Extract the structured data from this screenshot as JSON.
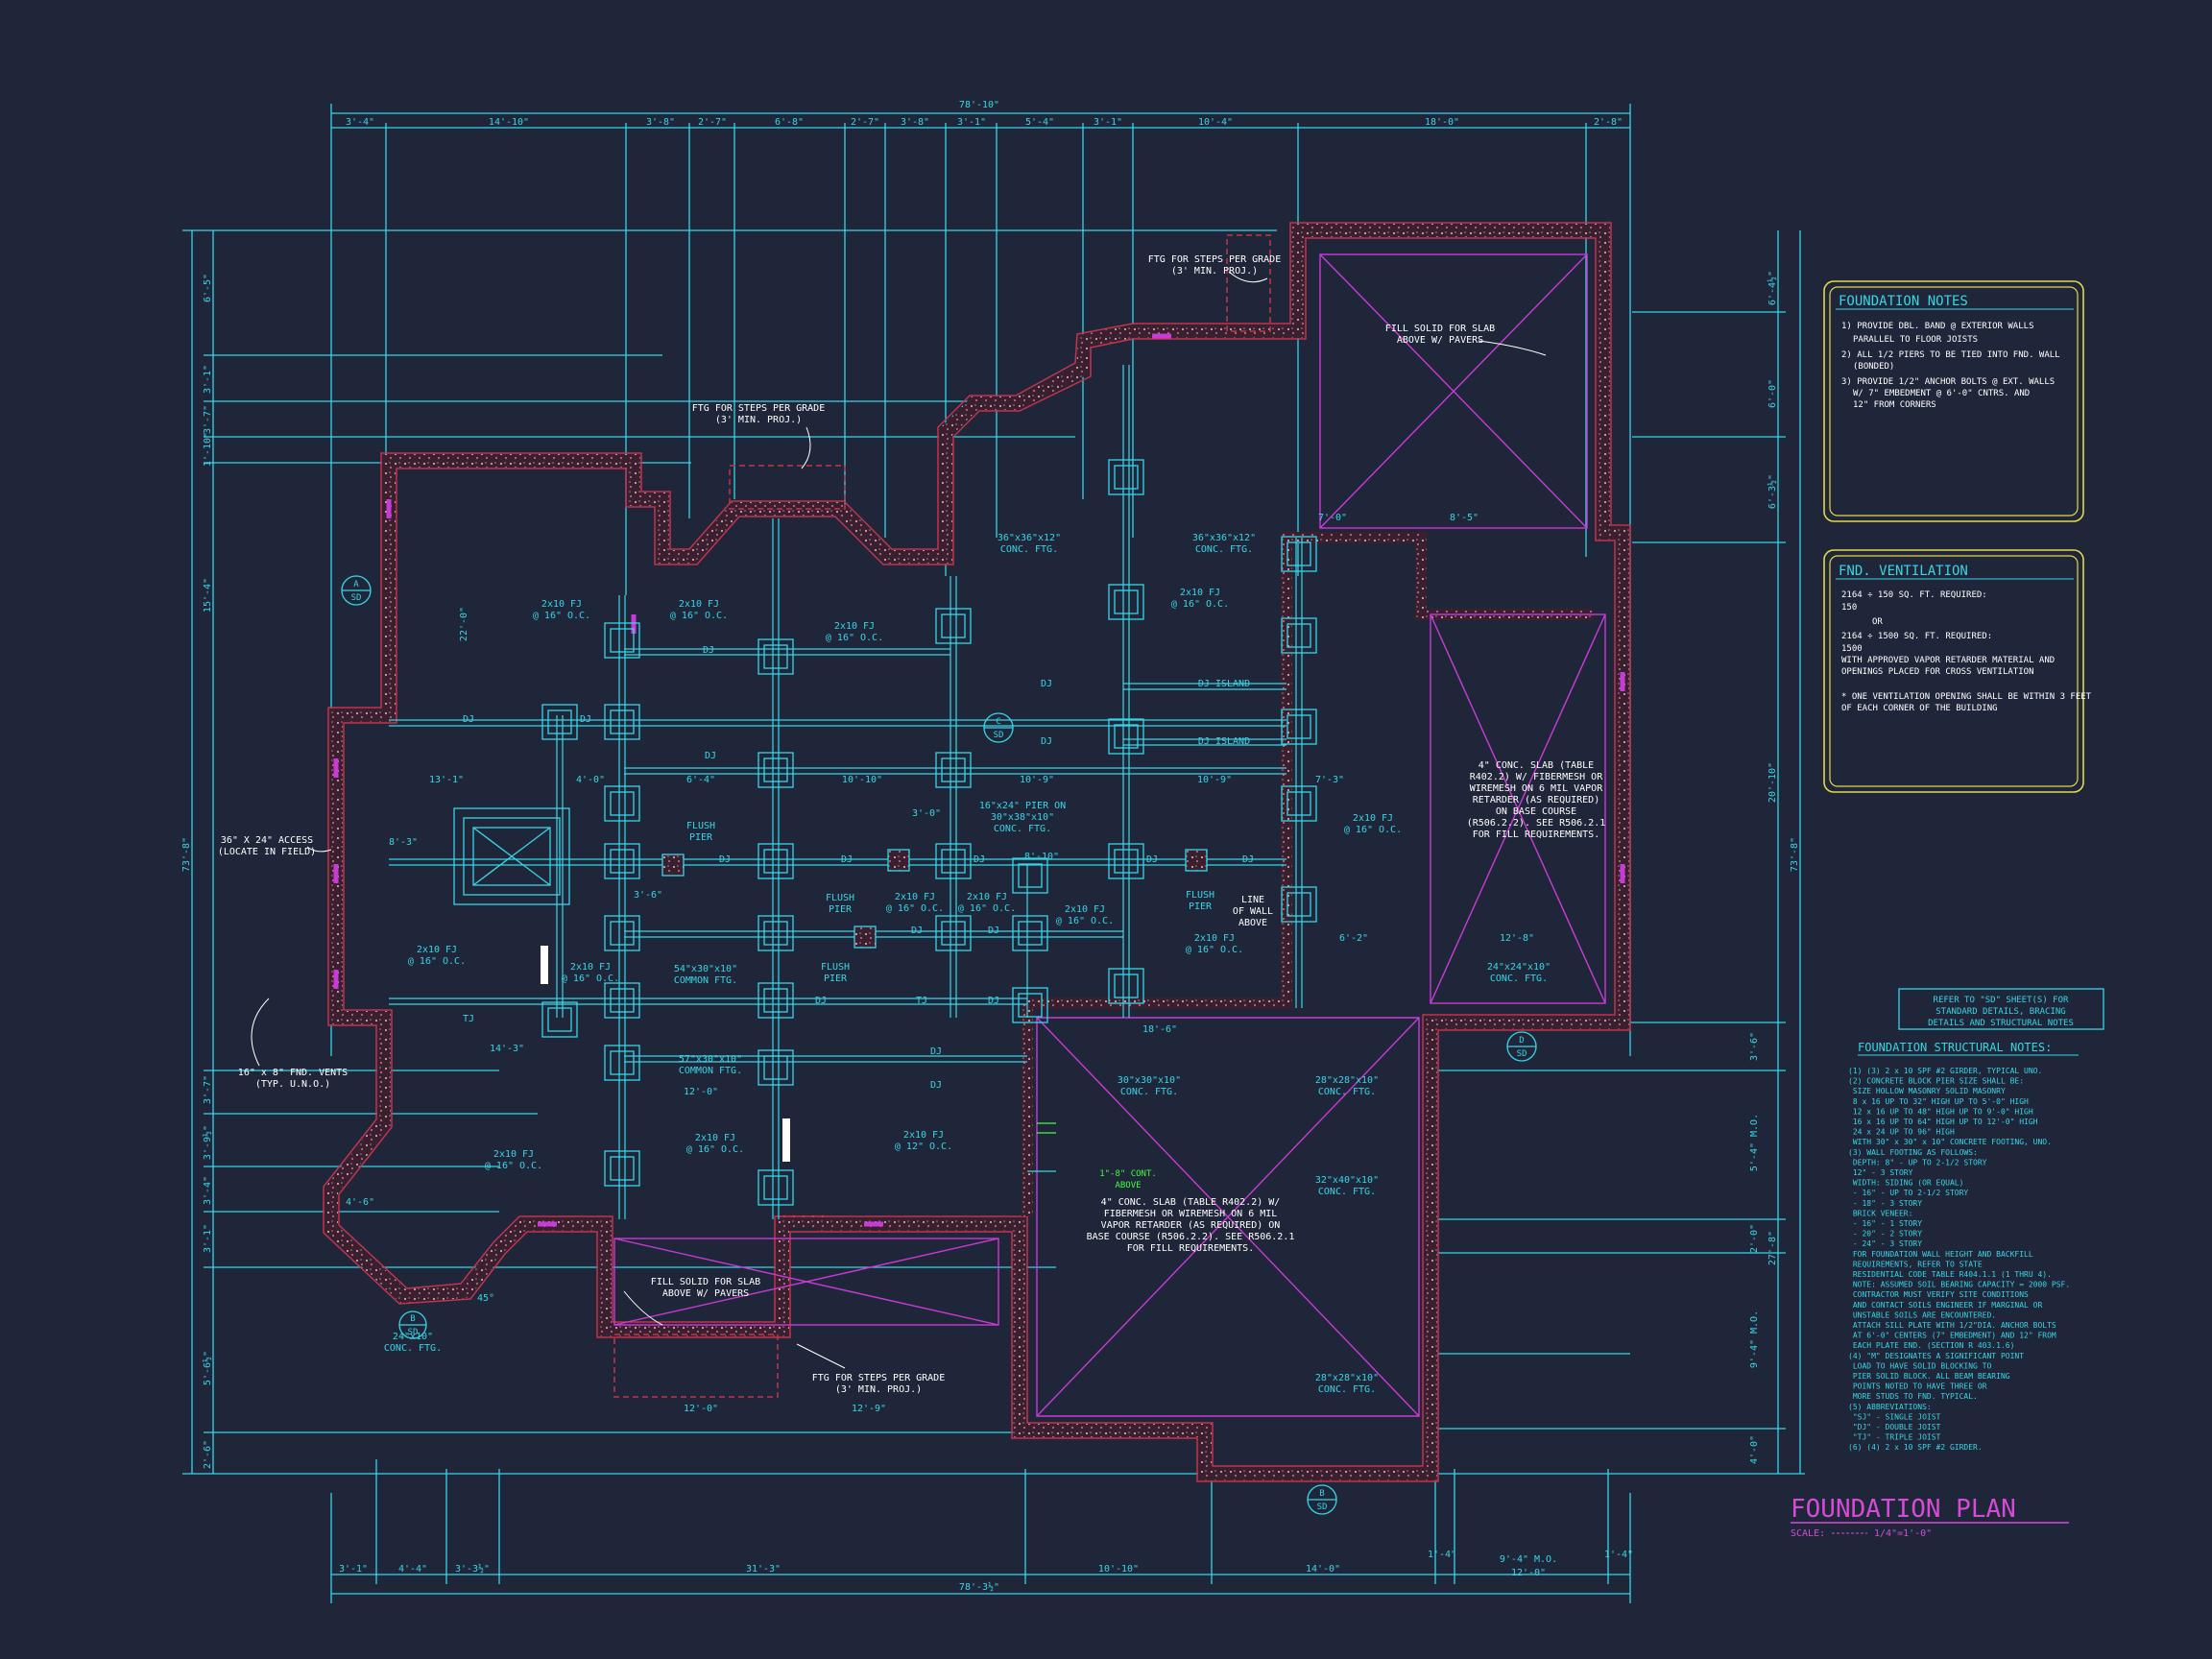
{
  "colors": {
    "background": "#202639",
    "dimension": "#37d6e6",
    "wall": "#c2334e",
    "wall_fill": "#6d2436",
    "slab_x": "#c93bd6",
    "notes_box": "#e3d84a",
    "title": "#d54bd6",
    "callout": "#ffffff",
    "green": "#3dff3d"
  },
  "dimensions": {
    "top_overall": "78'-10\"",
    "top_segments": [
      "3'-4\"",
      "14'-10\"",
      "3'-8\"",
      "2'-7\"",
      "6'-8\"",
      "2'-7\"",
      "3'-8\"",
      "3'-1\"",
      "5'-4\"",
      "3'-1\"",
      "10'-4\"",
      "18'-0\"",
      "2'-8\""
    ],
    "bottom_overall": "78'-3½\"",
    "bottom_segments": [
      "3'-1\"",
      "4'-4\"",
      "3'-3½\"",
      "31'-3\"",
      "10'-10\"",
      "14'-0\"",
      "1'-4\"",
      "9'-4\" M.O.",
      "1'-4\"",
      "12'-0\""
    ],
    "left_overall": "73'-8\"",
    "left_segments": [
      "6'-5\"",
      "3'-1\"",
      "3'-7\"",
      "1'-10\"",
      "15'-4\"",
      "3'-7\"",
      "3'-9½\"",
      "3'-4\"",
      "3'-1\"",
      "5'-6½\"",
      "2'-6\""
    ],
    "right_overall": "73'-8\"",
    "right_segments": [
      "6'-4½\"",
      "6'-0\"",
      "6'-3½\"",
      "20'-10\"",
      "3'-6\"",
      "5'-4\" M.O.",
      "2'-0\"",
      "9'-4\" M.O.",
      "4'-0\"",
      "27'-8\""
    ]
  },
  "plan_labels": {
    "ftg_steps_top": "FTG FOR STEPS PER GRADE\n(3' MIN. PROJ.)",
    "ftg_steps_mid": "FTG FOR STEPS PER GRADE\n(3' MIN. PROJ.)",
    "ftg_steps_bottom": "FTG FOR STEPS PER GRADE\n(3' MIN. PROJ.)",
    "fill_solid_top": "FILL SOLID FOR SLAB\nABOVE W/ PAVERS",
    "fill_solid_bottom": "FILL SOLID FOR SLAB\nABOVE W/ PAVERS",
    "conc_ftg_36": "36\"x36\"x12\"\nCONC. FTG.",
    "conc_ftg_36b": "36\"x36\"x12\"\nCONC. FTG.",
    "access": "36\" X 24\" ACCESS\n(LOCATE IN FIELD)",
    "vents": "16\" x 8\" FND. VENTS\n(TYP. U.N.O.)",
    "fj_1": "2x10 FJ\n@ 16\" O.C.",
    "fj_2": "2x10 FJ\n@ 16\" O.C.",
    "fj_3": "2x10 FJ\n@ 16\" O.C.",
    "fj_4": "2x10 FJ\n@ 16\" O.C.",
    "fj_5": "2x10 FJ\n@ 16\" O.C.",
    "fj_6": "2x10 FJ\n@ 16\" O.C.",
    "fj_7": "2x10 FJ\n@ 16\" O.C.",
    "fj_8": "2x10 FJ\n@ 16\" O.C.",
    "fj_9": "2x10 FJ\n@ 16\" O.C.",
    "fj_10": "2x10 FJ\n@ 12\" O.C.",
    "dj": "DJ",
    "dj_island_1": "DJ ISLAND",
    "dj_island_2": "DJ ISLAND",
    "tj": "TJ",
    "flush_pier_1": "FLUSH\nPIER",
    "flush_pier_2": "FLUSH\nPIER",
    "flush_pier_3": "FLUSH\nPIER",
    "flush_pier_4": "FLUSH\nPIER",
    "pier_16": "16\"x24\" PIER ON\n30\"x38\"x10\"\nCONC. FTG.",
    "common_ftg_1": "54\"x30\"x10\"\nCOMMON FTG.",
    "common_ftg_2": "57\"x30\"x10\"\nCOMMON FTG.",
    "slab_right": "4\" CONC. SLAB (TABLE\nR402.2) W/ FIBERMESH OR\nWIREMESH ON 6 MIL VAPOR\nRETARDER (AS REQUIRED)\nON BASE COURSE\n(R506.2.2). SEE R506.2.1\nFOR FILL REQUIREMENTS.",
    "slab_center": "4\" CONC. SLAB (TABLE R402.2) W/\nFIBERMESH OR WIREMESH ON 6 MIL\nVAPOR RETARDER (AS REQUIRED) ON\nBASE COURSE (R506.2.2). SEE R506.2.1\nFOR FILL REQUIREMENTS.",
    "ftg_30": "30\"x30\"x10\"\nCONC. FTG.",
    "ftg_28a": "28\"x28\"x10\"\nCONC. FTG.",
    "ftg_28b": "28\"x28\"x10\"\nCONC. FTG.",
    "ftg_32": "32\"x40\"x10\"\nCONC. FTG.",
    "ftg_24": "24\"x24\"x10\"\nCONC. FTG.",
    "ftg_24b": "24\"x10\"\nCONC. FTG.",
    "line_wall": "LINE\nOF WALL\nABOVE",
    "cont_above": "1\"-8\" CONT.\nABOVE",
    "interior_dims": [
      "13'-1\"",
      "6'-4\"",
      "8'-3\"",
      "4'-0\"",
      "10'-10\"",
      "10'-9\"",
      "10'-9\"",
      "7'-3\"",
      "6'-2\"",
      "12'-8\"",
      "18'-6\"",
      "14'-3\"",
      "4'-6\"",
      "3'-6\"",
      "8'-10\"",
      "12'-0\"",
      "12'-9\"",
      "12'-0\"",
      "3'-0\"",
      "7'-0\"",
      "8'-5\"",
      "22'-0\"",
      "45°"
    ]
  },
  "markers": [
    {
      "top": "A",
      "bottom": "SD"
    },
    {
      "top": "B",
      "bottom": "SD"
    },
    {
      "top": "C",
      "bottom": "SD"
    },
    {
      "top": "D",
      "bottom": "SD"
    },
    {
      "top": "B",
      "bottom": "SD"
    }
  ],
  "foundation_notes": {
    "title": "FOUNDATION NOTES",
    "items": [
      "1) PROVIDE DBL. BAND @ EXTERIOR WALLS",
      "PARALLEL TO FLOOR JOISTS",
      "2) ALL 1/2 PIERS TO BE TIED INTO FND. WALL",
      "(BONDED)",
      "3) PROVIDE 1/2\" ANCHOR BOLTS @ EXT. WALLS",
      "W/ 7\" EMBEDMENT @ 6'-0\" CNTRS. AND",
      "12\" FROM CORNERS"
    ]
  },
  "fnd_ventilation": {
    "title": "FND. VENTILATION",
    "items": [
      "2164 ÷ 150 SQ. FT. REQUIRED:",
      "150",
      "OR",
      "2164 ÷ 1500 SQ. FT. REQUIRED:",
      "1500",
      "WITH APPROVED VAPOR RETARDER MATERIAL AND",
      "OPENINGS PLACED FOR CROSS VENTILATION",
      "",
      "* ONE VENTILATION OPENING SHALL BE WITHIN 3 FEET",
      "  OF EACH CORNER OF THE BUILDING"
    ]
  },
  "refer_box": "REFER TO \"SD\" SHEET(S) FOR\nSTANDARD DETAILS, BRACING\nDETAILS AND STRUCTURAL NOTES",
  "structural_notes": {
    "title": "FOUNDATION STRUCTURAL NOTES:",
    "lines": [
      "(1) (3) 2 x 10 SPF #2 GIRDER, TYPICAL UNO.",
      "(2) CONCRETE BLOCK PIER SIZE SHALL BE:",
      "    SIZE    HOLLOW MASONRY    SOLID MASONRY",
      "    8 x 16    UP TO 32\" HIGH    UP TO 5'-0\" HIGH",
      "    12 x 16   UP TO 48\" HIGH    UP TO 9'-0\" HIGH",
      "    16 x 16   UP TO 64\" HIGH    UP TO 12'-0\" HIGH",
      "    24 x 24   UP TO 96\" HIGH",
      "    WITH 30\" x 30\" x 10\" CONCRETE FOOTING, UNO.",
      "(3) WALL FOOTING AS FOLLOWS:",
      "    DEPTH:  8\" - UP TO 2-1/2 STORY",
      "            12\" - 3 STORY",
      "    WIDTH:  SIDING (OR EQUAL)",
      "            - 16\" - UP TO 2-1/2 STORY",
      "            - 18\" - 3 STORY",
      "    BRICK VENEER:",
      "            - 16\" - 1 STORY",
      "            - 20\" - 2 STORY",
      "            - 24\" - 3 STORY",
      "    FOR FOUNDATION WALL HEIGHT AND BACKFILL",
      "    REQUIREMENTS, REFER TO STATE",
      "    RESIDENTIAL CODE TABLE R404.1.1 (1 THRU 4).",
      "    NOTE: ASSUMED SOIL BEARING CAPACITY = 2000 PSF.",
      "    CONTRACTOR MUST VERIFY SITE CONDITIONS",
      "    AND CONTACT SOILS ENGINEER IF MARGINAL OR",
      "    UNSTABLE SOILS ARE ENCOUNTERED.",
      "    ATTACH SILL PLATE WITH 1/2\"DIA. ANCHOR BOLTS",
      "    AT 6'-0\" CENTERS (7\" EMBEDMENT) AND 12\" FROM",
      "    EACH PLATE END. (SECTION R 403.1.6)",
      "(4) \"M\" DESIGNATES A SIGNIFICANT POINT",
      "    LOAD TO HAVE SOLID BLOCKING TO",
      "    PIER SOLID BLOCK. ALL BEAM BEARING",
      "    POINTS NOTED TO HAVE THREE OR",
      "    MORE STUDS TO FND. TYPICAL.",
      "(5) ABBREVIATIONS:",
      "    \"SJ\" - SINGLE JOIST",
      "    \"DJ\" - DOUBLE JOIST",
      "    \"TJ\" - TRIPLE JOIST",
      "(6) (4) 2 x 10 SPF #2 GIRDER."
    ]
  },
  "title_block": {
    "title": "FOUNDATION PLAN",
    "scale_label": "SCALE:",
    "scale_value": "1/4\"=1'-0\""
  }
}
